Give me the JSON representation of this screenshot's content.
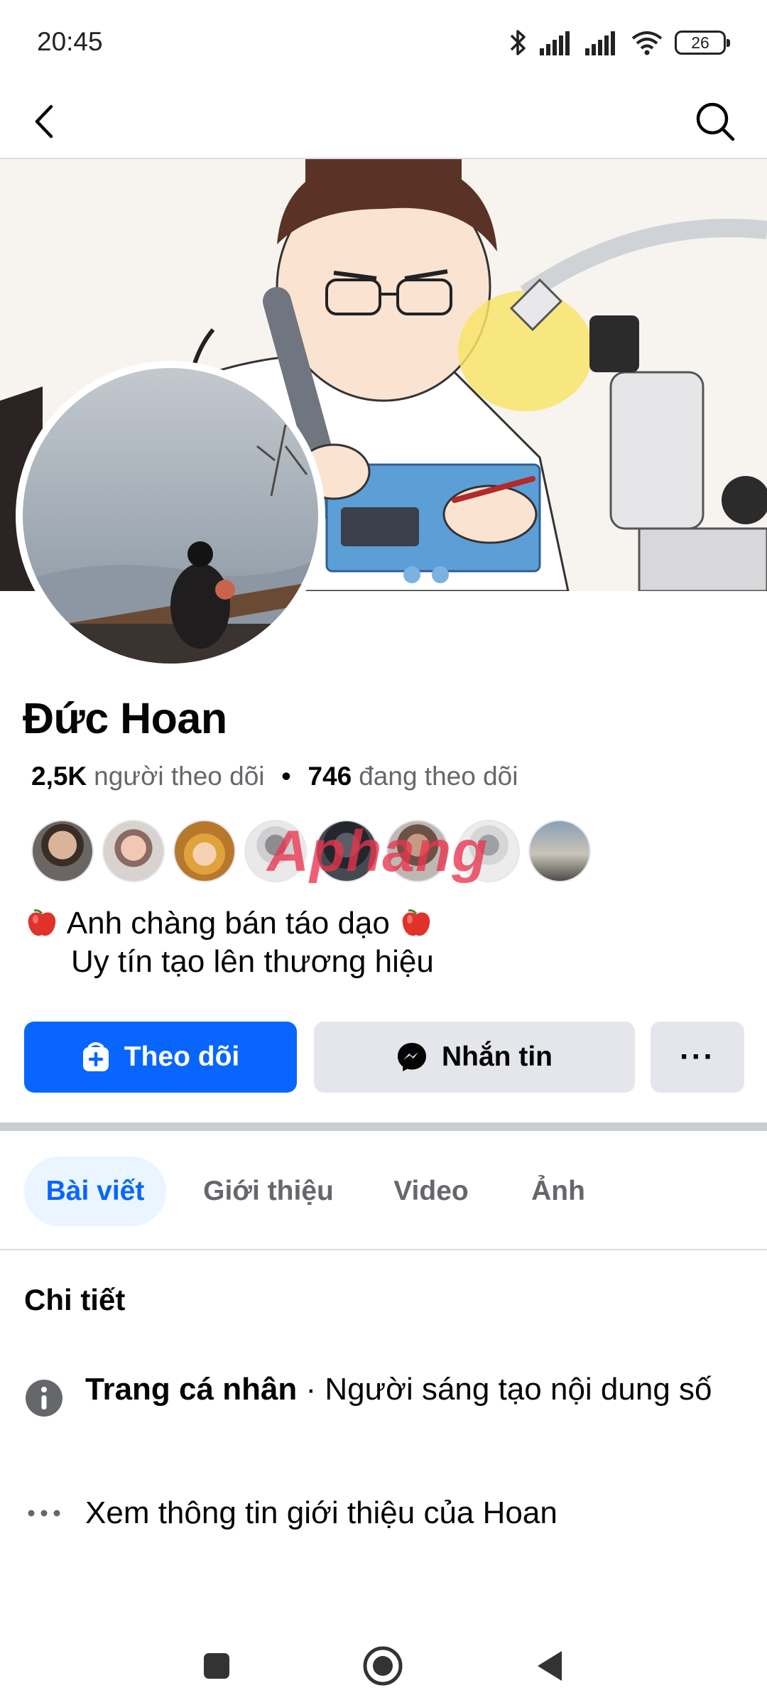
{
  "status_bar": {
    "time": "20:45",
    "battery": "26",
    "icons": [
      "bluetooth-icon",
      "signal-icon",
      "signal-icon",
      "wifi-icon",
      "battery-icon"
    ]
  },
  "header": {
    "back_icon": "chevron-left-icon",
    "search_icon": "search-icon"
  },
  "profile": {
    "name": "Đức Hoan",
    "followers_count": "2,5K",
    "followers_label": "người theo dõi",
    "separator": "•",
    "following_count": "746",
    "following_label": "đang theo dõi",
    "watermark": "Aphang",
    "bio_line1": "Anh chàng bán táo dạo",
    "bio_line2": "Uy tín tạo lên thương hiệu"
  },
  "actions": {
    "follow_label": "Theo dõi",
    "message_label": "Nhắn tin",
    "more_label": "···"
  },
  "tabs": [
    {
      "label": "Bài viết",
      "active": true
    },
    {
      "label": "Giới thiệu",
      "active": false
    },
    {
      "label": "Video",
      "active": false
    },
    {
      "label": "Ảnh",
      "active": false
    }
  ],
  "details": {
    "title": "Chi tiết",
    "page_type_bold": "Trang cá nhân",
    "page_type_rest": " · Người sáng tạo nội dung số",
    "see_about": "Xem thông tin giới thiệu của Hoan"
  },
  "colors": {
    "primary": "#0866ff",
    "secondary_button": "#e4e6eb",
    "active_tab_bg": "#ebf5ff",
    "muted_text": "#65676b"
  }
}
